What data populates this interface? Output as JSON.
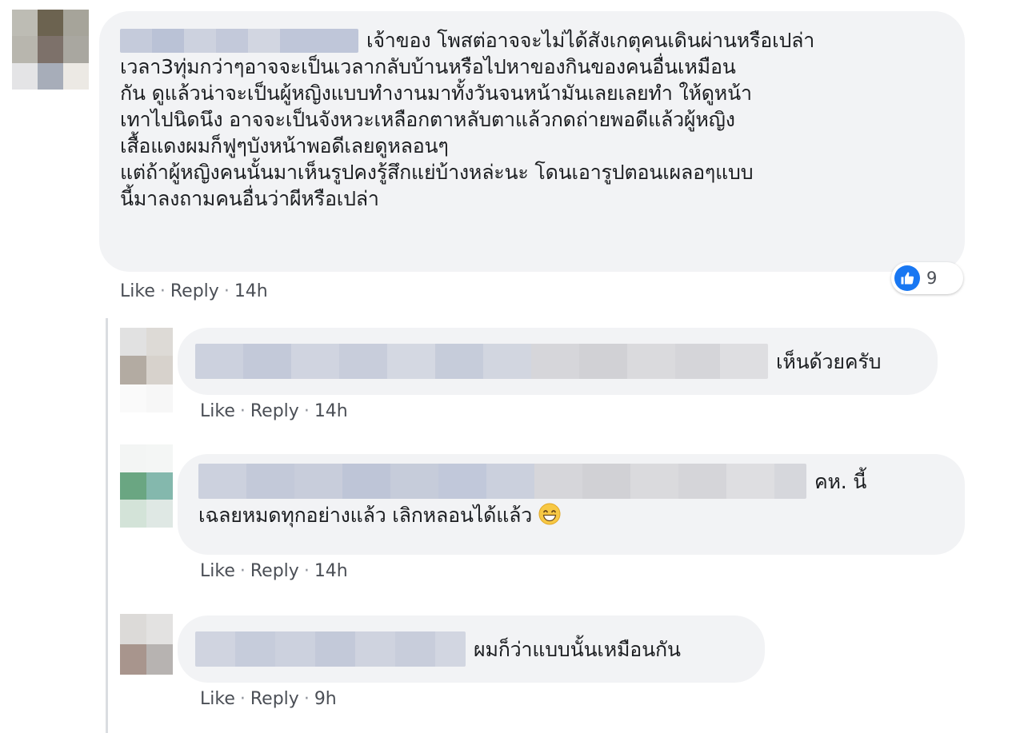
{
  "comments": [
    {
      "name_redacted": true,
      "text_lines": [
        "เจ้าของ โพสต่อาจจะไม่ได้สังเกตุคนเดินผ่านหรือเปล่า",
        "เวลา3ทุ่มกว่าๆอาจจะเป็นเวลากลับบ้านหรือไปหาของกินของคนอื่นเหมือน",
        "กัน ดูแล้วน่าจะเป็นผู้หญิงแบบทำงานมาทั้งวันจนหน้ามันเลยเลยทำ ให้ดูหน้า",
        "เทาไปนิดนึง อาจจะเป็นจังหวะเหลือกตาหลับตาแล้วกดถ่ายพอดีแล้วผู้หญิง",
        "เสื้อแดงผมก็ฟูๆบังหน้าพอดีเลยดูหลอนๆ",
        "แต่ถ้าผู้หญิงคนนั้นมาเห็นรูปคงรู้สึกแย่บ้างหล่ะนะ โดนเอารูปตอนเผลอๆแบบ",
        "นี้มาลงถามคนอื่นว่าผีหรือเปล่า"
      ],
      "like_label": "Like",
      "reply_label": "Reply",
      "time": "14h",
      "reaction_icon": "like-icon",
      "reaction_count": "9"
    }
  ],
  "replies": [
    {
      "name_redacted": true,
      "text": "เห็นด้วยครับ",
      "like_label": "Like",
      "reply_label": "Reply",
      "time": "14h"
    },
    {
      "name_redacted": true,
      "text_line1": "คห. นี้",
      "text_line2": "เฉลยหมดทุกอย่างแล้ว เลิกหลอนได้แล้ว",
      "emoji": "grinning-face-emoji",
      "like_label": "Like",
      "reply_label": "Reply",
      "time": "14h"
    },
    {
      "name_redacted": true,
      "text": "ผมก็ว่าแบบนั้นเหมือนกัน",
      "like_label": "Like",
      "reply_label": "Reply",
      "time": "9h"
    }
  ],
  "separator": "·",
  "colors": {
    "bubble": "#f2f3f5",
    "link": "#4b4f56",
    "like_blue": "#1877f2"
  }
}
